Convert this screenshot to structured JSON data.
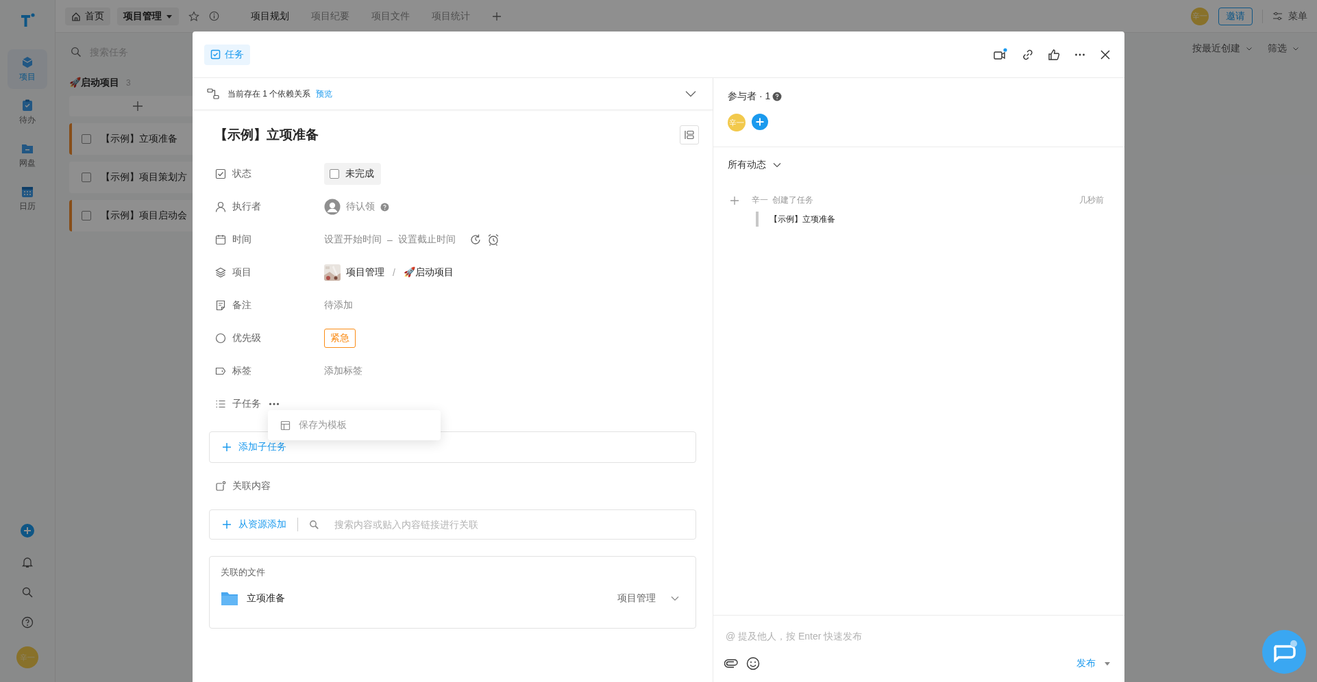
{
  "app": {
    "rail": {
      "items": [
        {
          "label": "项目",
          "selected": true
        },
        {
          "label": "待办",
          "selected": false
        },
        {
          "label": "网盘",
          "selected": false
        },
        {
          "label": "日历",
          "selected": false
        }
      ],
      "avatar": "辛一"
    },
    "topbar": {
      "home": "首页",
      "project": "项目管理",
      "tabs": [
        {
          "label": "项目规划",
          "selected": true
        },
        {
          "label": "项目纪要",
          "selected": false
        },
        {
          "label": "项目文件",
          "selected": false
        },
        {
          "label": "项目统计",
          "selected": false
        }
      ],
      "avatar": "辛一",
      "invite": "邀请",
      "menu": "菜单"
    },
    "toolbar": {
      "sort": "按最近创建",
      "filter": "筛选"
    },
    "task_list": {
      "search_placeholder": "搜索任务",
      "group": {
        "title": "🚀启动项目",
        "count": "3"
      },
      "tasks": [
        {
          "title": "【示例】立项准备",
          "checked": false,
          "flagged": true
        },
        {
          "title": "【示例】项目策划方",
          "checked": false,
          "flagged": false
        },
        {
          "title": "【示例】项目启动会",
          "checked": false,
          "flagged": true
        }
      ]
    }
  },
  "dialog": {
    "type_tag": "任务",
    "dependency": {
      "text": "当前存在 1 个依赖关系",
      "link": "预览"
    },
    "title": "【示例】立项准备",
    "fields": [
      {
        "kind": "status",
        "label": "状态",
        "value": "未完成",
        "checked": false
      },
      {
        "kind": "assignee",
        "label": "执行者",
        "value": "待认领"
      },
      {
        "kind": "time",
        "label": "时间",
        "start": "设置开始时间",
        "separator": "–",
        "end": "设置截止时间"
      },
      {
        "kind": "project",
        "label": "项目",
        "project": "项目管理",
        "separator": "/",
        "group": "🚀启动项目"
      },
      {
        "kind": "note",
        "label": "备注",
        "placeholder": "待添加"
      },
      {
        "kind": "priority",
        "label": "优先级",
        "value": "紧急"
      },
      {
        "kind": "tags",
        "label": "标签",
        "placeholder": "添加标签"
      }
    ],
    "subtasks": {
      "label": "子任务",
      "add": "添加子任务",
      "menu": [
        {
          "label": "保存为模板"
        }
      ]
    },
    "related": {
      "label": "关联内容",
      "add": "从资源添加",
      "search_placeholder": "搜索内容或贴入内容链接进行关联"
    },
    "files": {
      "title": "关联的文件",
      "items": [
        {
          "name": "立项准备",
          "location": "项目管理"
        }
      ]
    },
    "participants": {
      "title": "参与者 · 1",
      "avatars": [
        "辛一"
      ]
    },
    "activity": {
      "filter": "所有动态",
      "items": [
        {
          "actor": "辛一",
          "action": "创建了任务",
          "time": "几秒前",
          "quote": "【示例】立项准备"
        }
      ]
    },
    "comment": {
      "placeholder": "@ 提及他人，按 Enter 快速发布",
      "submit": "发布"
    }
  }
}
